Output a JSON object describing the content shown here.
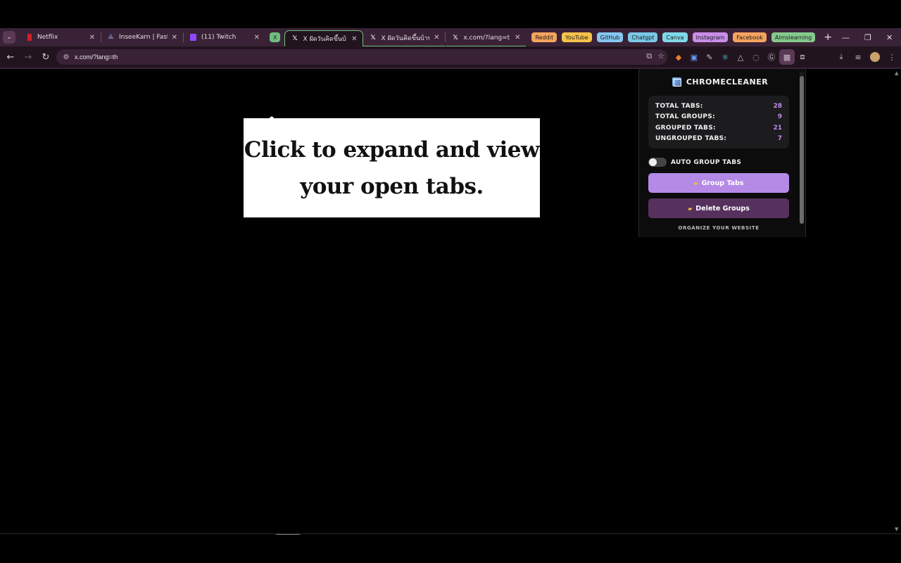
{
  "tabs": [
    {
      "title": "Netflix",
      "favicon": "netflix-icon",
      "color": "#d0202a"
    },
    {
      "title": "InseeKarn | Fastwo",
      "favicon": "fastwork-icon"
    },
    {
      "title": "(11) Twitch",
      "favicon": "twitch-icon"
    }
  ],
  "group_x": {
    "label": "X",
    "color": "#71bd7f"
  },
  "grouped_tabs": [
    {
      "title": "X ฝัดวันคิดขึ้นบ้าน / X",
      "favicon": "x-icon",
      "active": true
    },
    {
      "title": "X ฝัดวันคิดขึ้นบ้าน / X",
      "favicon": "x-icon"
    },
    {
      "title": "x.com/?lang=th",
      "favicon": "x-icon"
    }
  ],
  "tab_groups": [
    {
      "label": "Reddit",
      "color": "#f5a35e"
    },
    {
      "label": "YouTube",
      "color": "#f5c24a"
    },
    {
      "label": "GitHub",
      "color": "#86c6f0"
    },
    {
      "label": "Chatgpt",
      "color": "#79c8e6"
    },
    {
      "label": "Canva",
      "color": "#7fd8e8"
    },
    {
      "label": "Instagram",
      "color": "#c88ee8"
    },
    {
      "label": "Facebook",
      "color": "#f5a35e"
    },
    {
      "label": "Aimslearning",
      "color": "#85c98c"
    }
  ],
  "address_bar": {
    "url": "x.com/?lang=th"
  },
  "callout": {
    "text": "Click to expand and view your open tabs."
  },
  "popup": {
    "title": "CHROMECLEANER",
    "stats": [
      {
        "label": "TOTAL TABS:",
        "value": "28"
      },
      {
        "label": "TOTAL GROUPS:",
        "value": "9"
      },
      {
        "label": "GROUPED TABS:",
        "value": "21"
      },
      {
        "label": "UNGROUPED TABS:",
        "value": "7"
      }
    ],
    "toggle_label": "AUTO GROUP TABS",
    "toggle_on": false,
    "group_button": "Group Tabs",
    "delete_button": "Delete Groups",
    "footer": "ORGANIZE YOUR WEBSITE"
  },
  "colors": {
    "accent": "#b58ae6",
    "frame": "#3a2236",
    "toolbar": "#22141f"
  }
}
